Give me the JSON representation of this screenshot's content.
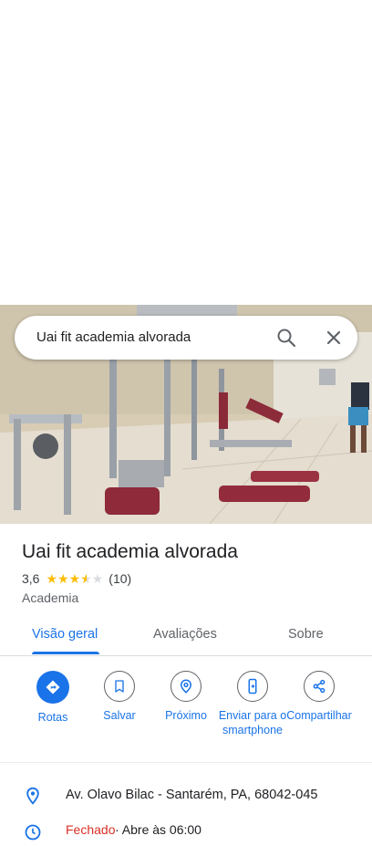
{
  "search": {
    "query": "Uai fit academia alvorada"
  },
  "place": {
    "name": "Uai fit academia alvorada",
    "rating": "3,6",
    "rating_value": 3.6,
    "review_count": "(10)",
    "category": "Academia"
  },
  "tabs": [
    {
      "label": "Visão geral",
      "active": true
    },
    {
      "label": "Avaliações",
      "active": false
    },
    {
      "label": "Sobre",
      "active": false
    }
  ],
  "actions": [
    {
      "label": "Rotas",
      "icon": "directions-icon"
    },
    {
      "label": "Salvar",
      "icon": "bookmark-icon"
    },
    {
      "label": "Próximo",
      "icon": "nearby-icon"
    },
    {
      "label": "Enviar para o smartphone",
      "icon": "send-to-phone-icon"
    },
    {
      "label": "Compartilhar",
      "icon": "share-icon"
    }
  ],
  "info": {
    "address": "Av. Olavo Bilac - Santarém, PA, 68042-045",
    "hours_status": "Fechado",
    "hours_detail": "· Abre às 06:00"
  },
  "colors": {
    "accent": "#1a73e8",
    "star": "#fbbc04",
    "closed": "#d93025"
  }
}
